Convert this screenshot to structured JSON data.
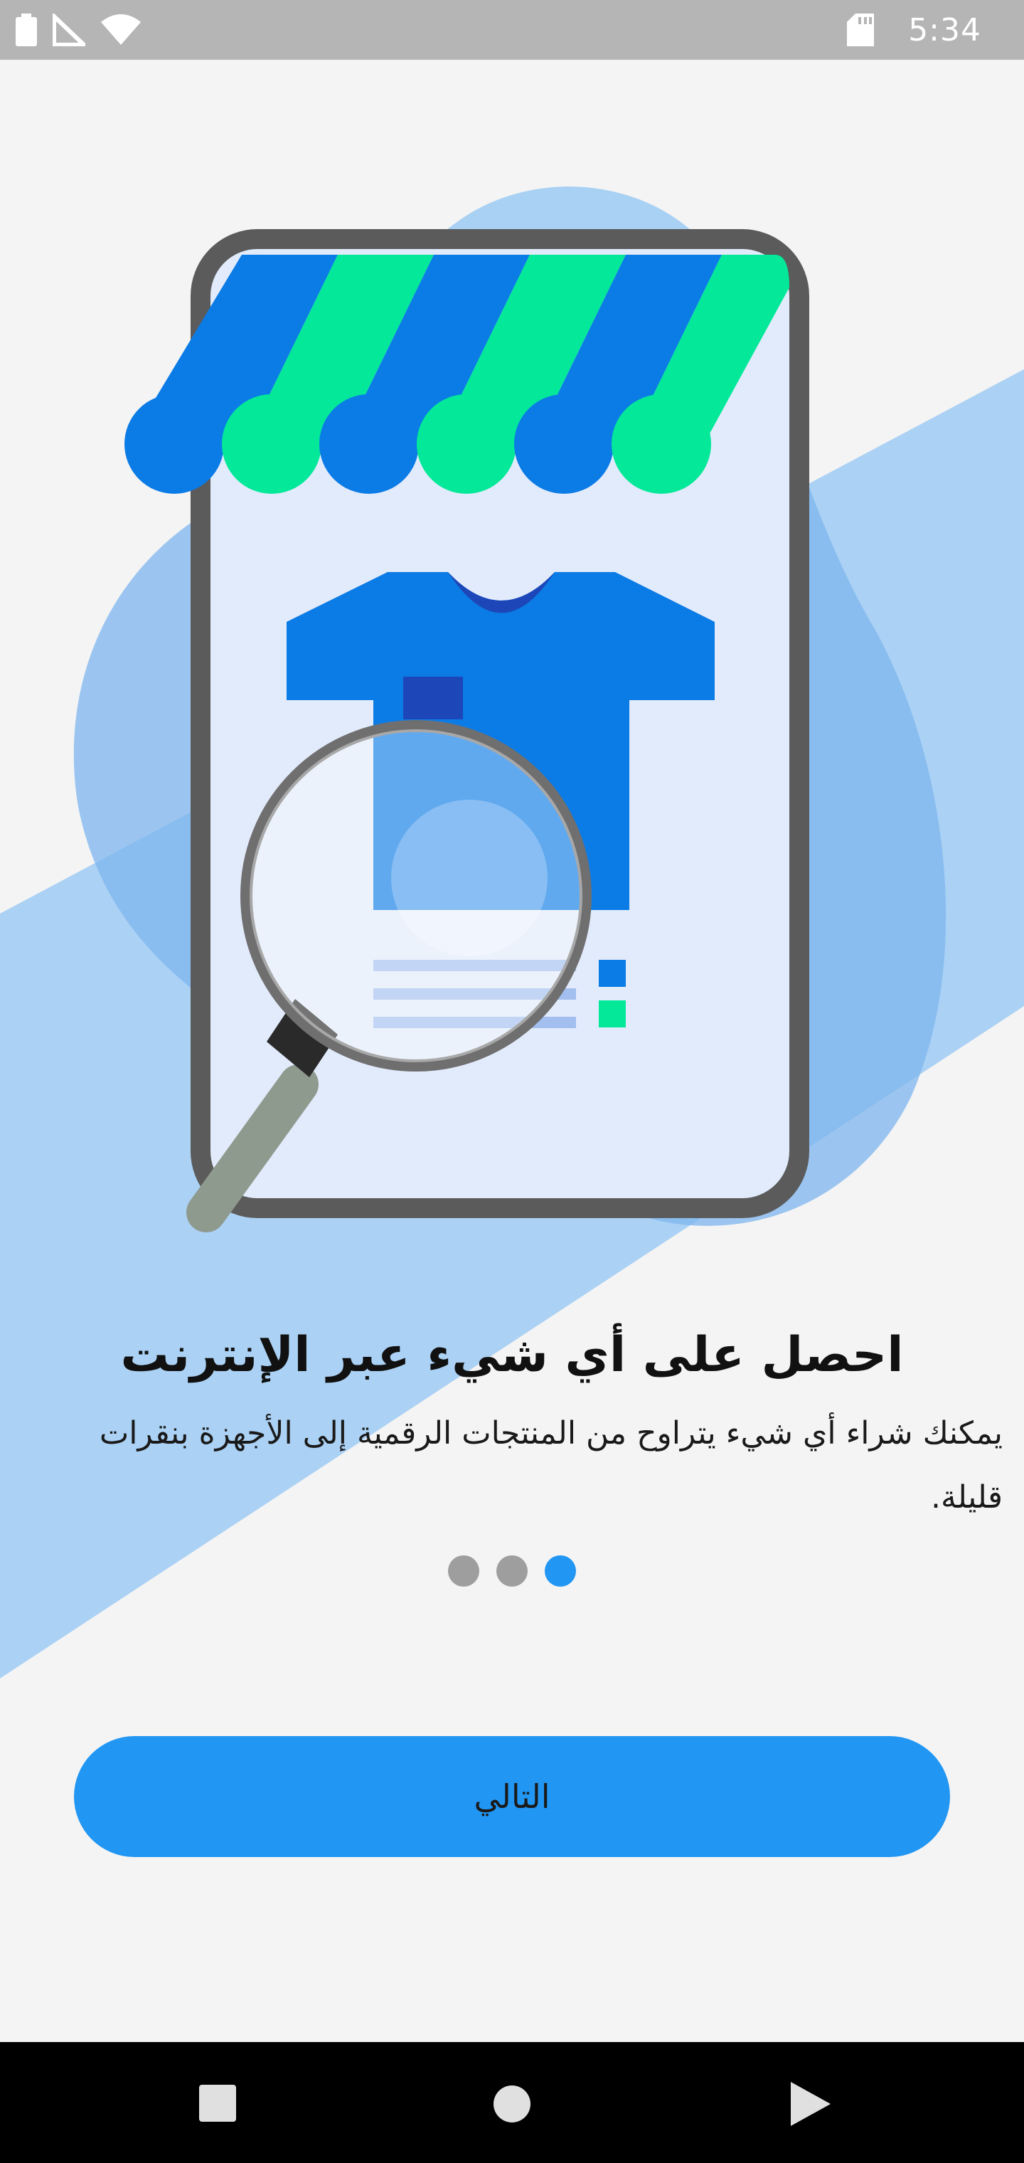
{
  "status_bar": {
    "time": "5:34",
    "icons": [
      "battery-icon",
      "signal-icon",
      "wifi-icon",
      "sd-card-icon"
    ]
  },
  "onboarding": {
    "title": "احصل على أي شيء عبر الإنترنت",
    "description": "يمكنك شراء أي شيء يتراوح من المنتجات الرقمية إلى الأجهزة بنقرات قليلة.",
    "pages_total": 3,
    "current_page": 3,
    "next_label": "التالي"
  },
  "nav_bar": {
    "icons": [
      "recents-square-icon",
      "home-circle-icon",
      "back-triangle-icon"
    ]
  },
  "colors": {
    "accent": "#2196f3",
    "illustration_blue": "#0b7be6",
    "illustration_green": "#03e899",
    "background": "#f4f4f4"
  }
}
